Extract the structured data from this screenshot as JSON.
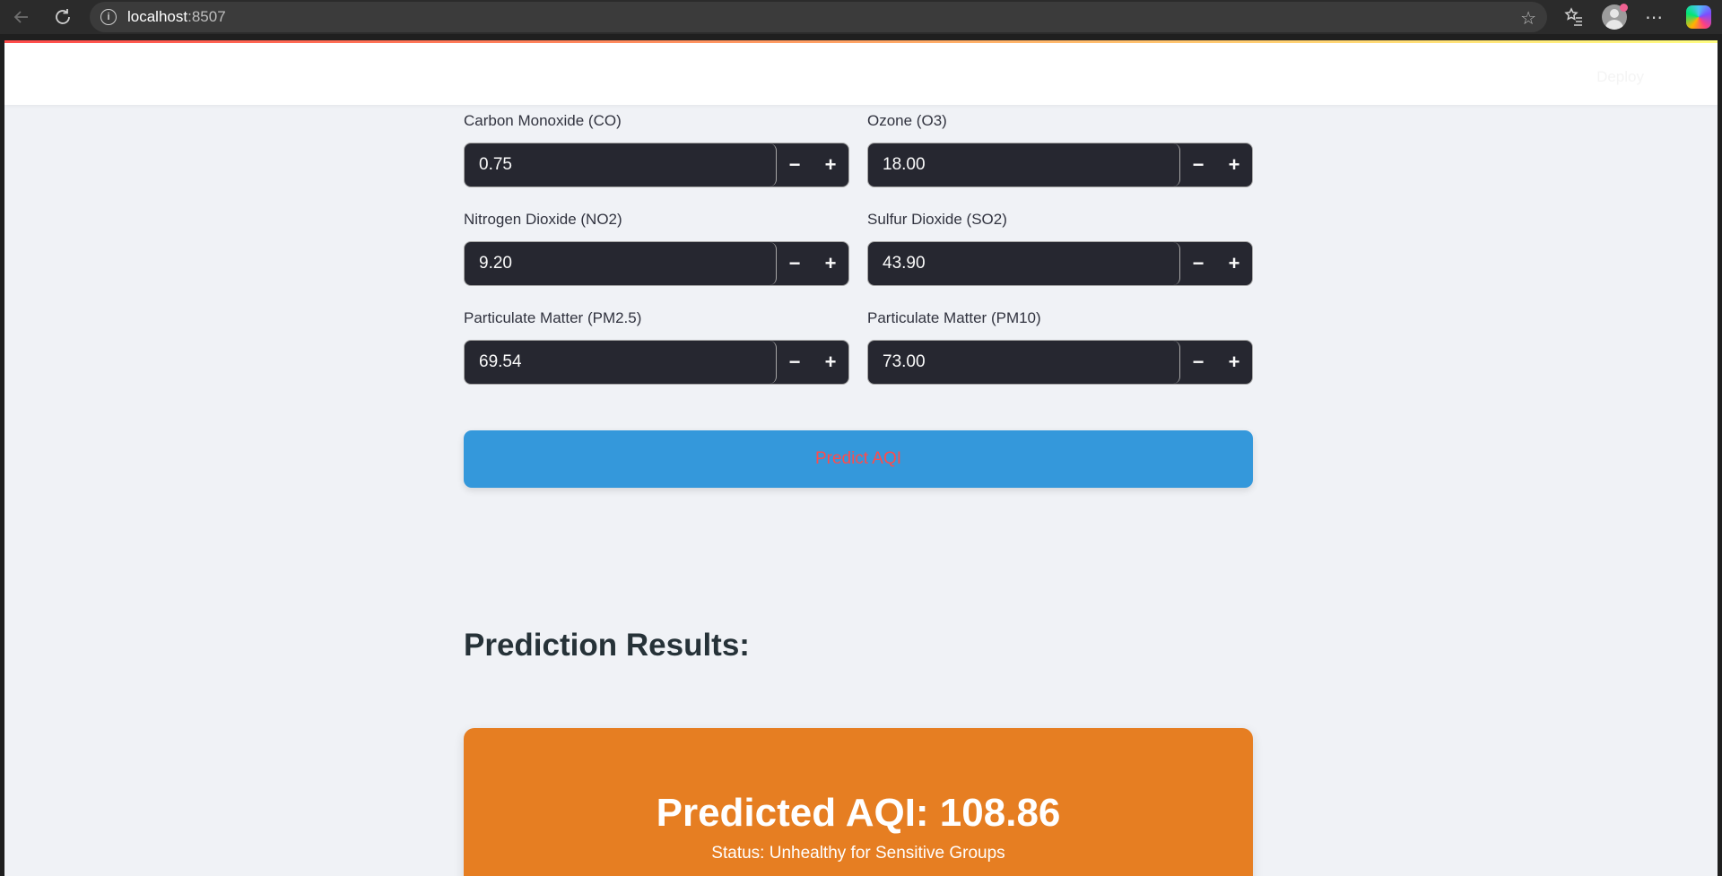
{
  "browser": {
    "url_host": "localhost",
    "url_port": ":8507"
  },
  "app": {
    "deploy_label": "Deploy"
  },
  "inputs": [
    {
      "label": "Carbon Monoxide (CO)",
      "value": "0.75"
    },
    {
      "label": "Ozone (O3)",
      "value": "18.00"
    },
    {
      "label": "Nitrogen Dioxide (NO2)",
      "value": "9.20"
    },
    {
      "label": "Sulfur Dioxide (SO2)",
      "value": "43.90"
    },
    {
      "label": "Particulate Matter (PM2.5)",
      "value": "69.54"
    },
    {
      "label": "Particulate Matter (PM10)",
      "value": "73.00"
    }
  ],
  "stepper": {
    "minus": "−",
    "plus": "+"
  },
  "predict_button": "Predict AQI",
  "results": {
    "title": "Prediction Results:",
    "aqi_text": "Predicted AQI: 108.86",
    "status_text": "Status: Unhealthy for Sensitive Groups",
    "card_color": "#e67e22"
  },
  "colors": {
    "button_bg": "#3498db",
    "button_text": "#ff4b4b",
    "input_bg": "#262730",
    "page_bg": "#f0f2f6"
  }
}
